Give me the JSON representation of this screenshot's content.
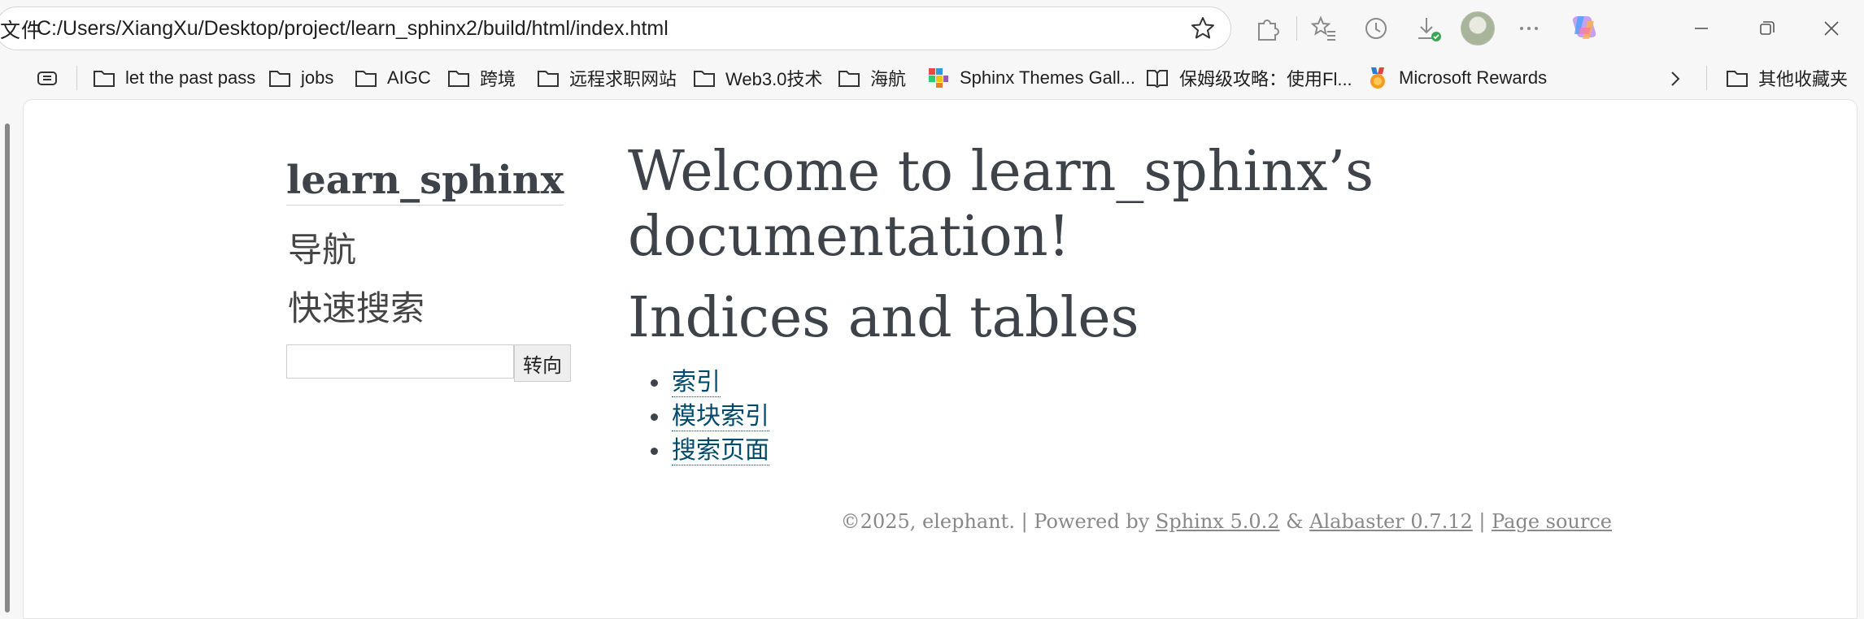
{
  "browser": {
    "file_label": "文件",
    "address": "C:/Users/XiangXu/Desktop/project/learn_sphinx2/build/html/index.html"
  },
  "bookmarks": [
    {
      "label": "let the past pass",
      "icon": "folder-icon"
    },
    {
      "label": "jobs",
      "icon": "folder-icon"
    },
    {
      "label": "AIGC",
      "icon": "folder-icon"
    },
    {
      "label": "跨境",
      "icon": "folder-icon"
    },
    {
      "label": "远程求职网站",
      "icon": "folder-icon"
    },
    {
      "label": "Web3.0技术",
      "icon": "folder-icon"
    },
    {
      "label": "海航",
      "icon": "folder-icon"
    },
    {
      "label": "Sphinx Themes Gall...",
      "icon": "sphinx-favicon-icon"
    },
    {
      "label": "保姆级攻略：使用Fl...",
      "icon": "book-icon"
    },
    {
      "label": "Microsoft Rewards",
      "icon": "rewards-medal-icon"
    },
    {
      "label": "其他收藏夹",
      "icon": "folder-icon"
    }
  ],
  "sidebar": {
    "project_title": "learn_sphinx",
    "nav_heading": "导航",
    "search_heading": "快速搜索",
    "search_button": "转向"
  },
  "content": {
    "title": "Welcome to learn_sphinx’s documentation!",
    "title_line1": "Welcome to learn_sphinx’s",
    "title_line2": "documentation!",
    "indices_heading": "Indices and tables",
    "links": [
      "索引",
      "模块索引",
      "搜索页面"
    ]
  },
  "footer": {
    "copyright": "©2025, elephant.",
    "sep1": " | Powered by ",
    "sphinx_link": "Sphinx 5.0.2",
    "amp": " & ",
    "alabaster_link": "Alabaster 0.7.12",
    "sep2": " | ",
    "source_link": "Page source"
  },
  "colors": {
    "heading": "#3e4349",
    "link": "#004b6b",
    "footer": "#888888"
  }
}
